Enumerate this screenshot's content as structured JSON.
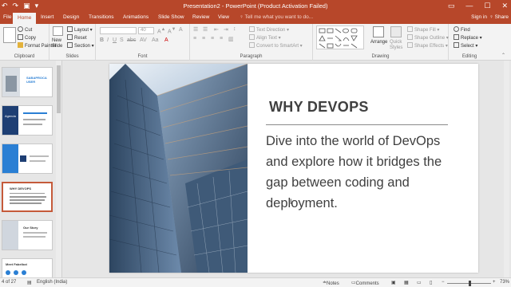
{
  "titlebar": {
    "title": "Presentation2 - PowerPoint (Product Activation Failed)",
    "qat": [
      "↶",
      "↷",
      "▣",
      "▾"
    ],
    "window_controls": [
      "▭",
      "—",
      "☐",
      "✕"
    ]
  },
  "tabs": [
    "File",
    "Home",
    "Insert",
    "Design",
    "Transitions",
    "Animations",
    "Slide Show",
    "Review",
    "View"
  ],
  "active_tab": "Home",
  "tellme": "♀ Tell me what you want to do...",
  "signin": "Sign in",
  "share": "♀ Share",
  "ribbon": {
    "clipboard": {
      "label": "Clipboard",
      "paste": "Paste",
      "cut": "Cut",
      "copy": "Copy",
      "format_painter": "Format Painter"
    },
    "slides": {
      "label": "Slides",
      "new_slide": "New Slide",
      "layout": "Layout",
      "reset": "Reset",
      "section": "Section"
    },
    "font": {
      "label": "Font",
      "size": "40"
    },
    "paragraph": {
      "label": "Paragraph",
      "text_direction": "Text Direction",
      "align_text": "Align Text",
      "convert_smartart": "Convert to SmartArt"
    },
    "drawing": {
      "label": "Drawing",
      "arrange": "Arrange",
      "quick_styles": "Quick Styles",
      "shape_fill": "Shape Fill",
      "shape_outline": "Shape Outline",
      "shape_effects": "Shape Effects"
    },
    "editing": {
      "label": "Editing",
      "find": "Find",
      "replace": "Replace",
      "select": "Select"
    }
  },
  "thumbnails": [
    {
      "title": "SABAPROCA USER",
      "selected": false
    },
    {
      "title": "Agenda",
      "selected": false
    },
    {
      "title": "",
      "selected": false
    },
    {
      "title": "WHY DEVOPS",
      "selected": true
    },
    {
      "title": "Our Story",
      "selected": false
    },
    {
      "title": "Meet Fabelbot",
      "selected": false
    }
  ],
  "slide": {
    "title": "WHY DEVOPS",
    "body": "Dive into the world of DevOps and explore how it bridges the gap between coding and deployment."
  },
  "statusbar": {
    "slide_info": "4 of 27",
    "language": "English (India)",
    "notes": "Notes",
    "comments": "Comments",
    "zoom": "73%"
  },
  "colors": {
    "accent": "#b7472a",
    "selection": "#c55a3a"
  }
}
